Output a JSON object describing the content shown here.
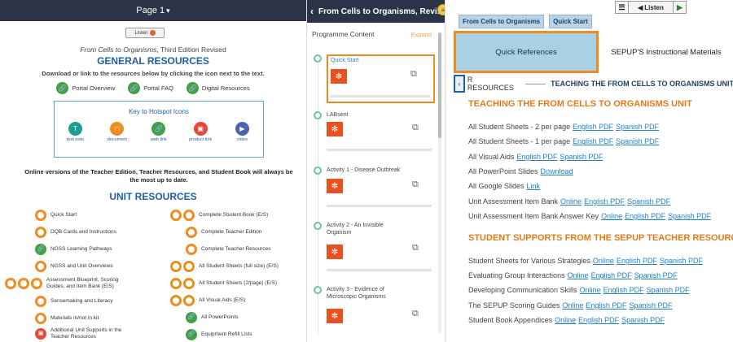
{
  "left": {
    "page_label": "Page 1",
    "listen_label": "Listen",
    "subtitle_italic": "From Cells to Organisms",
    "subtitle_rest": ", Third Edition Revised",
    "general_title": "GENERAL RESOURCES",
    "download_text": "Download or link to the resources below by clicking the icon next to the text.",
    "general_links": [
      "Portal Overview",
      "Portal FAQ",
      "Digital Resources"
    ],
    "hotspot_title": "Key to Hotspot Icons",
    "hotspot_items": [
      "text note",
      "document",
      "web link",
      "product link",
      "video"
    ],
    "online_text": "Online versions of the Teacher Edition, Teacher Resources, and Student Book will always be the most up to date.",
    "unit_title": "UNIT RESOURCES",
    "unit_left": [
      "Quick Start",
      "DQB Cards and Instructions",
      "NGSS Learning Pathways",
      "NGSS and Unit Overviews",
      "Assessment Blueprint, Scoring Guides, and Item Bank (E/S)",
      "Sensemaking and Literacy",
      "Materials in/not in kit",
      "Additional Unit Supports in the Teacher Resources"
    ],
    "unit_right": [
      "Complete Student Book (E/S)",
      "Complete Teacher Edition",
      "Complete Teacher Resources",
      "All Student Sheets (full size) (E/S)",
      "All Student Sheets (2/page) (E/S)",
      "All Visual Aids (E/S)",
      "All PowerPoints",
      "Equipment Refill Lists"
    ]
  },
  "mid": {
    "title": "From Cells to Organisms, Revi...",
    "programme_label": "Programme Content",
    "expand_label": "Expand",
    "modules": [
      "Quick Start",
      "LABsent",
      "Activity 1 - Disease Outbreak",
      "Activity 2 - An Invisible Organism",
      "Activity 3 - Evidence of Microscopic Organisms"
    ]
  },
  "right": {
    "listen_label": "Listen",
    "crumbs": [
      "From Cells to Organisms",
      "Quick Start"
    ],
    "tab_active": "Quick References",
    "tab_other": "SEPUP'S Instructional Materials",
    "nav_prev": "R RESOURCES",
    "nav_current": "TEACHING THE FROM CELLS TO ORGANISMS UNIT",
    "section1_title": "TEACHING THE FROM CELLS TO ORGANISMS UNIT",
    "section1_rows": [
      {
        "label": "All Student Sheets - 2 per page",
        "links": [
          "English PDF",
          "Spanish PDF"
        ]
      },
      {
        "label": "All Student Sheets - 1 per page",
        "links": [
          "English PDF",
          "Spanish PDF"
        ]
      },
      {
        "label": "All Visual Aids",
        "links": [
          "English PDF",
          "Spanish PDF"
        ]
      },
      {
        "label": "All PowerPoint Slides",
        "links": [
          "Download"
        ]
      },
      {
        "label": "All Google Slides",
        "links": [
          "Link"
        ]
      },
      {
        "label": "Unit Assessment Item Bank",
        "links": [
          "Online",
          "English PDF",
          "Spanish PDF"
        ]
      },
      {
        "label": "Unit Assessment Item Bank Answer Key",
        "links": [
          "Online",
          "English PDF",
          "Spanish PDF"
        ]
      }
    ],
    "section2_title": "STUDENT SUPPORTS FROM THE SEPUP TEACHER RESOURCES",
    "section2_rows": [
      {
        "label": "Student Sheets for Various Strategies",
        "links": [
          "Online",
          "English PDF",
          "Spanish PDF"
        ]
      },
      {
        "label": "Evaluating Group Interactions",
        "links": [
          "Online",
          "English PDF",
          "Spanish PDF"
        ]
      },
      {
        "label": "Developing Communication Skills",
        "links": [
          "Online",
          "English PDF",
          "Spanish PDF"
        ]
      },
      {
        "label": "The SEPUP Scoring Guides",
        "links": [
          "Online",
          "English PDF",
          "Spanish PDF"
        ]
      },
      {
        "label": "Student Book Appendices",
        "links": [
          "Online",
          "English PDF",
          "Spanish PDF"
        ]
      }
    ]
  }
}
